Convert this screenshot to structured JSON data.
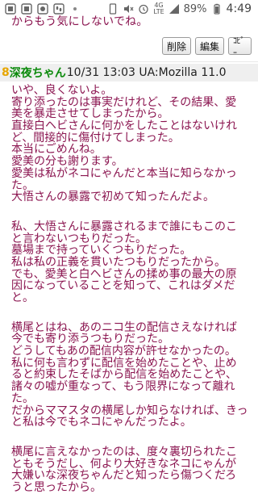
{
  "statusbar": {
    "network": [
      "4G",
      "LTE"
    ],
    "battery": "89%",
    "time": "4:49"
  },
  "previous_post": {
    "tail_text": "からもう気にしないでね。"
  },
  "buttons": {
    "delete": "削除",
    "edit": "編集",
    "copy": "ｺﾋﾟｰ"
  },
  "post": {
    "number": "8",
    "name": "深夜ちゃん",
    "meta": "10/31 13:03 UA:Mozilla 11.0",
    "paragraphs": [
      [
        "いや、良くないよ。",
        "寄り添ったのは事実だけれど、その結果、愛",
        "美を暴走させてしまったから。",
        "直接白ヘビさんに何かをしたことはないけれ",
        "ど、間接的に傷付けてしまった。",
        "本当にごめんね。",
        "愛美の分も謝ります。",
        "愛美は私がネコにゃんだと本当に知らなかっ",
        "た。",
        "大悟さんの暴露で初めて知ったんだよ。"
      ],
      [
        "私、大悟さんに暴露されるまで誰にもこのこ",
        "と言わないつもりだった。",
        "墓場まで持っていくつもりだった。",
        "私は私の正義を貫いたつもりだったから。",
        "でも、愛美と白ヘビさんの揉め事の最大の原",
        "因になっていることを知って、これはダメだ",
        "と。"
      ],
      [
        "横尾とはね、あのニコ生の配信さえなければ",
        "今でも寄り添うつもりだった。",
        "どうしてもあの配信内容が許せなかったの。",
        "私に何も言わずに配信を始めたことや、止め",
        "ると約束したそばから配信を始めたことや、",
        "諸々の嘘が重なって、もう限界になって離れ",
        "た。",
        "だからママスタの横尾しか知らなければ、きっ",
        "と私は今でもネコにゃんだったよ。"
      ],
      [
        "横尾に言えなかったのは、度々裏切られたこ",
        "ともそうだし、何より大好きなネコにゃんが",
        "大嫌いな深夜ちゃんだと知ったら傷つくだろ",
        "うと思ったから。"
      ]
    ]
  }
}
